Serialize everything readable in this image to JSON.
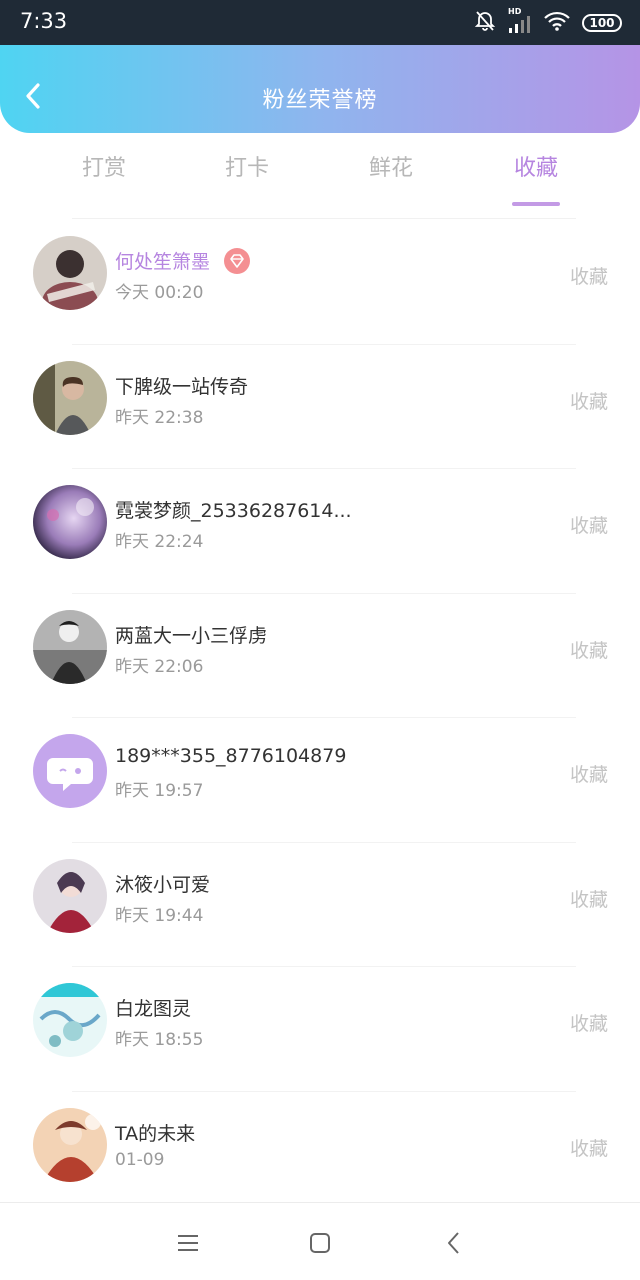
{
  "status_bar": {
    "time": "7:33",
    "battery": "100",
    "network_label": "HD",
    "icons": [
      "alarm-off-icon",
      "signal-icon",
      "wifi-icon",
      "battery-icon"
    ]
  },
  "header": {
    "title": "粉丝荣誉榜",
    "back_icon": "chevron-left-icon"
  },
  "tabs": [
    {
      "label": "打赏",
      "active": false
    },
    {
      "label": "打卡",
      "active": false
    },
    {
      "label": "鲜花",
      "active": false
    },
    {
      "label": "收藏",
      "active": true
    }
  ],
  "fans": [
    {
      "name": "何处笙箫墨",
      "time": "今天 00:20",
      "action": "收藏",
      "highlight": true,
      "badge": "diamond-icon"
    },
    {
      "name": "下脾级一站传奇",
      "time": "昨天 22:38",
      "action": "收藏"
    },
    {
      "name": "霓裳梦颜_25336287614...",
      "time": "昨天 22:24",
      "action": "收藏"
    },
    {
      "name": "两蒕大一小三俘虏",
      "time": "昨天 22:06",
      "action": "收藏"
    },
    {
      "name": "189***355_8776104879",
      "time": "昨天 19:57",
      "action": "收藏"
    },
    {
      "name": "沐筱小可爱",
      "time": "昨天 19:44",
      "action": "收藏"
    },
    {
      "name": "白龙图灵",
      "time": "昨天 18:55",
      "action": "收藏"
    },
    {
      "name": "TA的未来",
      "time": "01-09",
      "action": "收藏"
    }
  ],
  "system_nav": {
    "icons": [
      "menu-icon",
      "home-square-icon",
      "back-icon"
    ]
  },
  "colors": {
    "accent": "#b685e0",
    "gradient_start": "#4fd4f2",
    "gradient_end": "#b594e6"
  }
}
